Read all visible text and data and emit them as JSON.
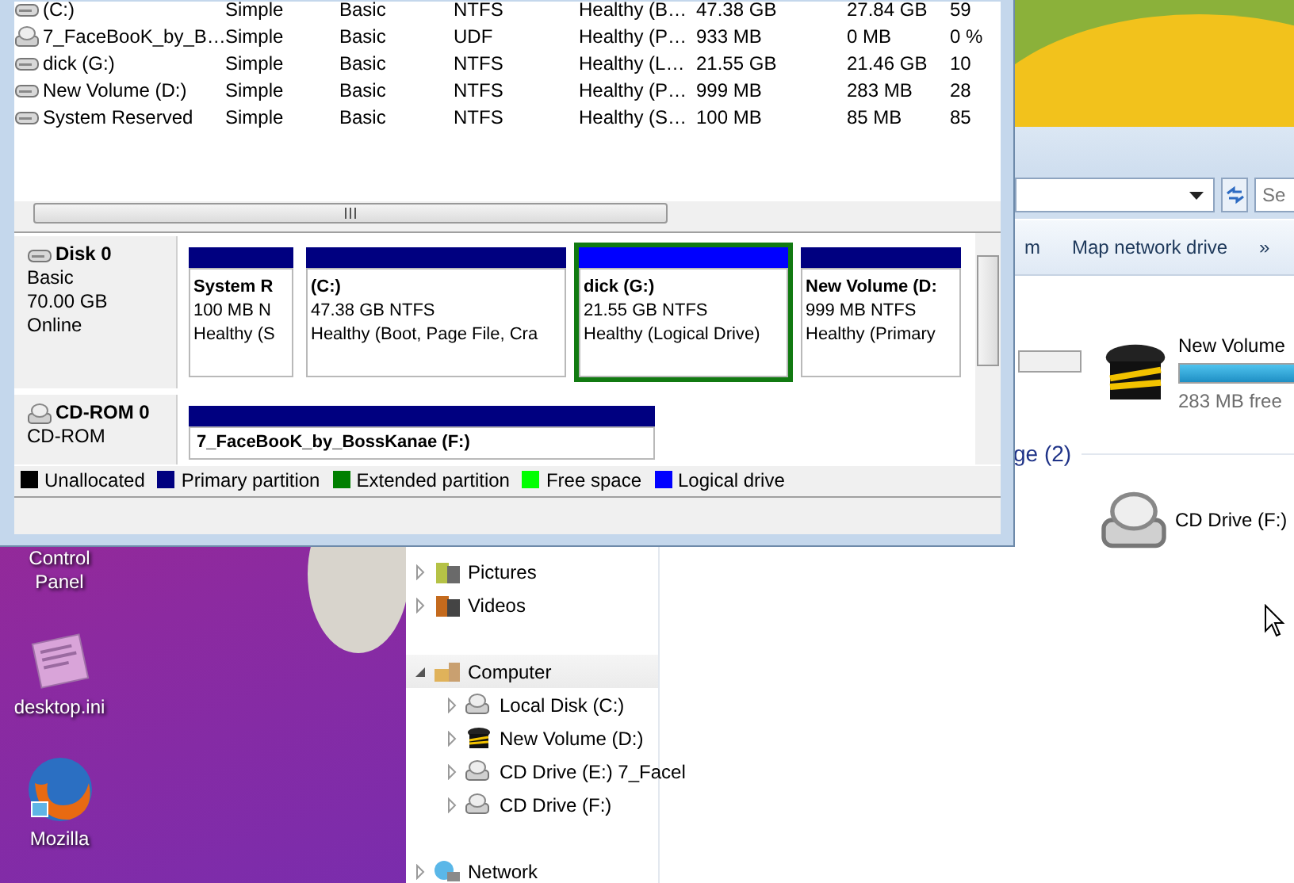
{
  "desktop": {
    "icons": [
      {
        "label": "Control Panel",
        "kind": "hidden"
      },
      {
        "label": "desktop.ini",
        "kind": "file"
      },
      {
        "label": "Mozilla",
        "kind": "browser"
      }
    ]
  },
  "explorer": {
    "search_placeholder": "Se",
    "commands": [
      {
        "label": "m"
      },
      {
        "label": "Map network drive"
      },
      {
        "label": "»"
      }
    ],
    "nav_tree": [
      {
        "label": "Pictures",
        "kind": "pictures",
        "expanded": false,
        "selected": false
      },
      {
        "label": "Videos",
        "kind": "videos",
        "expanded": false,
        "selected": false
      },
      {
        "label": "Computer",
        "kind": "computer",
        "expanded": true,
        "selected": true,
        "children": [
          {
            "label": "Local Disk (C:)",
            "kind": "cd",
            "expanded": false,
            "selected": false
          },
          {
            "label": "New Volume (D:)",
            "kind": "volume",
            "expanded": false,
            "selected": false
          },
          {
            "label": "CD Drive (E:) 7_Facel",
            "kind": "cd",
            "expanded": false,
            "selected": false
          },
          {
            "label": "CD Drive (F:)",
            "kind": "cd",
            "expanded": false,
            "selected": false
          }
        ]
      },
      {
        "label": "Network",
        "kind": "network",
        "expanded": false,
        "selected": false
      }
    ],
    "cut_drive_bar": {
      "level": 0
    },
    "hard_disks": [
      {
        "name": "New Volume",
        "kind": "volume",
        "level": 0.72,
        "free_text": "283 MB free"
      }
    ],
    "removable_heading": "ge (2)",
    "removable": [
      {
        "name": "CD Drive (F:)",
        "kind": "cd"
      }
    ]
  },
  "disk_management": {
    "volumes": [
      {
        "kind": "disk",
        "cells": [
          "(C:)",
          "Simple",
          "Basic",
          "NTFS",
          "Healthy (B…",
          "47.38 GB",
          "27.84 GB",
          "59"
        ]
      },
      {
        "kind": "cd",
        "cells": [
          "7_FaceBooK_by_B…",
          "Simple",
          "Basic",
          "UDF",
          "Healthy (P…",
          "933 MB",
          "0 MB",
          "0 %"
        ]
      },
      {
        "kind": "disk",
        "cells": [
          "dick (G:)",
          "Simple",
          "Basic",
          "NTFS",
          "Healthy (L…",
          "21.55 GB",
          "21.46 GB",
          "10"
        ]
      },
      {
        "kind": "disk",
        "cells": [
          "New Volume (D:)",
          "Simple",
          "Basic",
          "NTFS",
          "Healthy (P…",
          "999 MB",
          "283 MB",
          "28"
        ]
      },
      {
        "kind": "disk",
        "cells": [
          "System Reserved",
          "Simple",
          "Basic",
          "NTFS",
          "Healthy (S…",
          "100 MB",
          "85 MB",
          "85"
        ]
      }
    ],
    "disks": [
      {
        "name": "Disk 0",
        "kind": "disk",
        "lines": [
          "Basic",
          "70.00 GB",
          "Online"
        ],
        "partitions": [
          {
            "name": "System R",
            "lines": [
              "100 MB N",
              "Healthy (S"
            ],
            "color": "#000080",
            "selected": false
          },
          {
            "name": "(C:)",
            "lines": [
              "47.38 GB NTFS",
              "Healthy (Boot, Page File, Cra"
            ],
            "color": "#000080",
            "selected": false
          },
          {
            "name": "dick  (G:)",
            "lines": [
              "21.55 GB NTFS",
              "Healthy (Logical Drive)"
            ],
            "color": "#0000ff",
            "selected": true
          },
          {
            "name": "New Volume  (D:",
            "lines": [
              "999 MB NTFS",
              "Healthy (Primary"
            ],
            "color": "#000080",
            "selected": false
          }
        ]
      },
      {
        "name": "CD-ROM 0",
        "kind": "cd",
        "lines": [
          "CD-ROM"
        ],
        "partitions": [
          {
            "name": "7_FaceBooK_by_BossKanae  (F:)",
            "color": "#000080",
            "selected": false
          }
        ]
      }
    ],
    "legend": [
      {
        "label": "Unallocated",
        "color": "#000000"
      },
      {
        "label": "Primary partition",
        "color": "#000080"
      },
      {
        "label": "Extended partition",
        "color": "#008000"
      },
      {
        "label": "Free space",
        "color": "#00ff00"
      },
      {
        "label": "Logical drive",
        "color": "#0000ff"
      }
    ]
  }
}
